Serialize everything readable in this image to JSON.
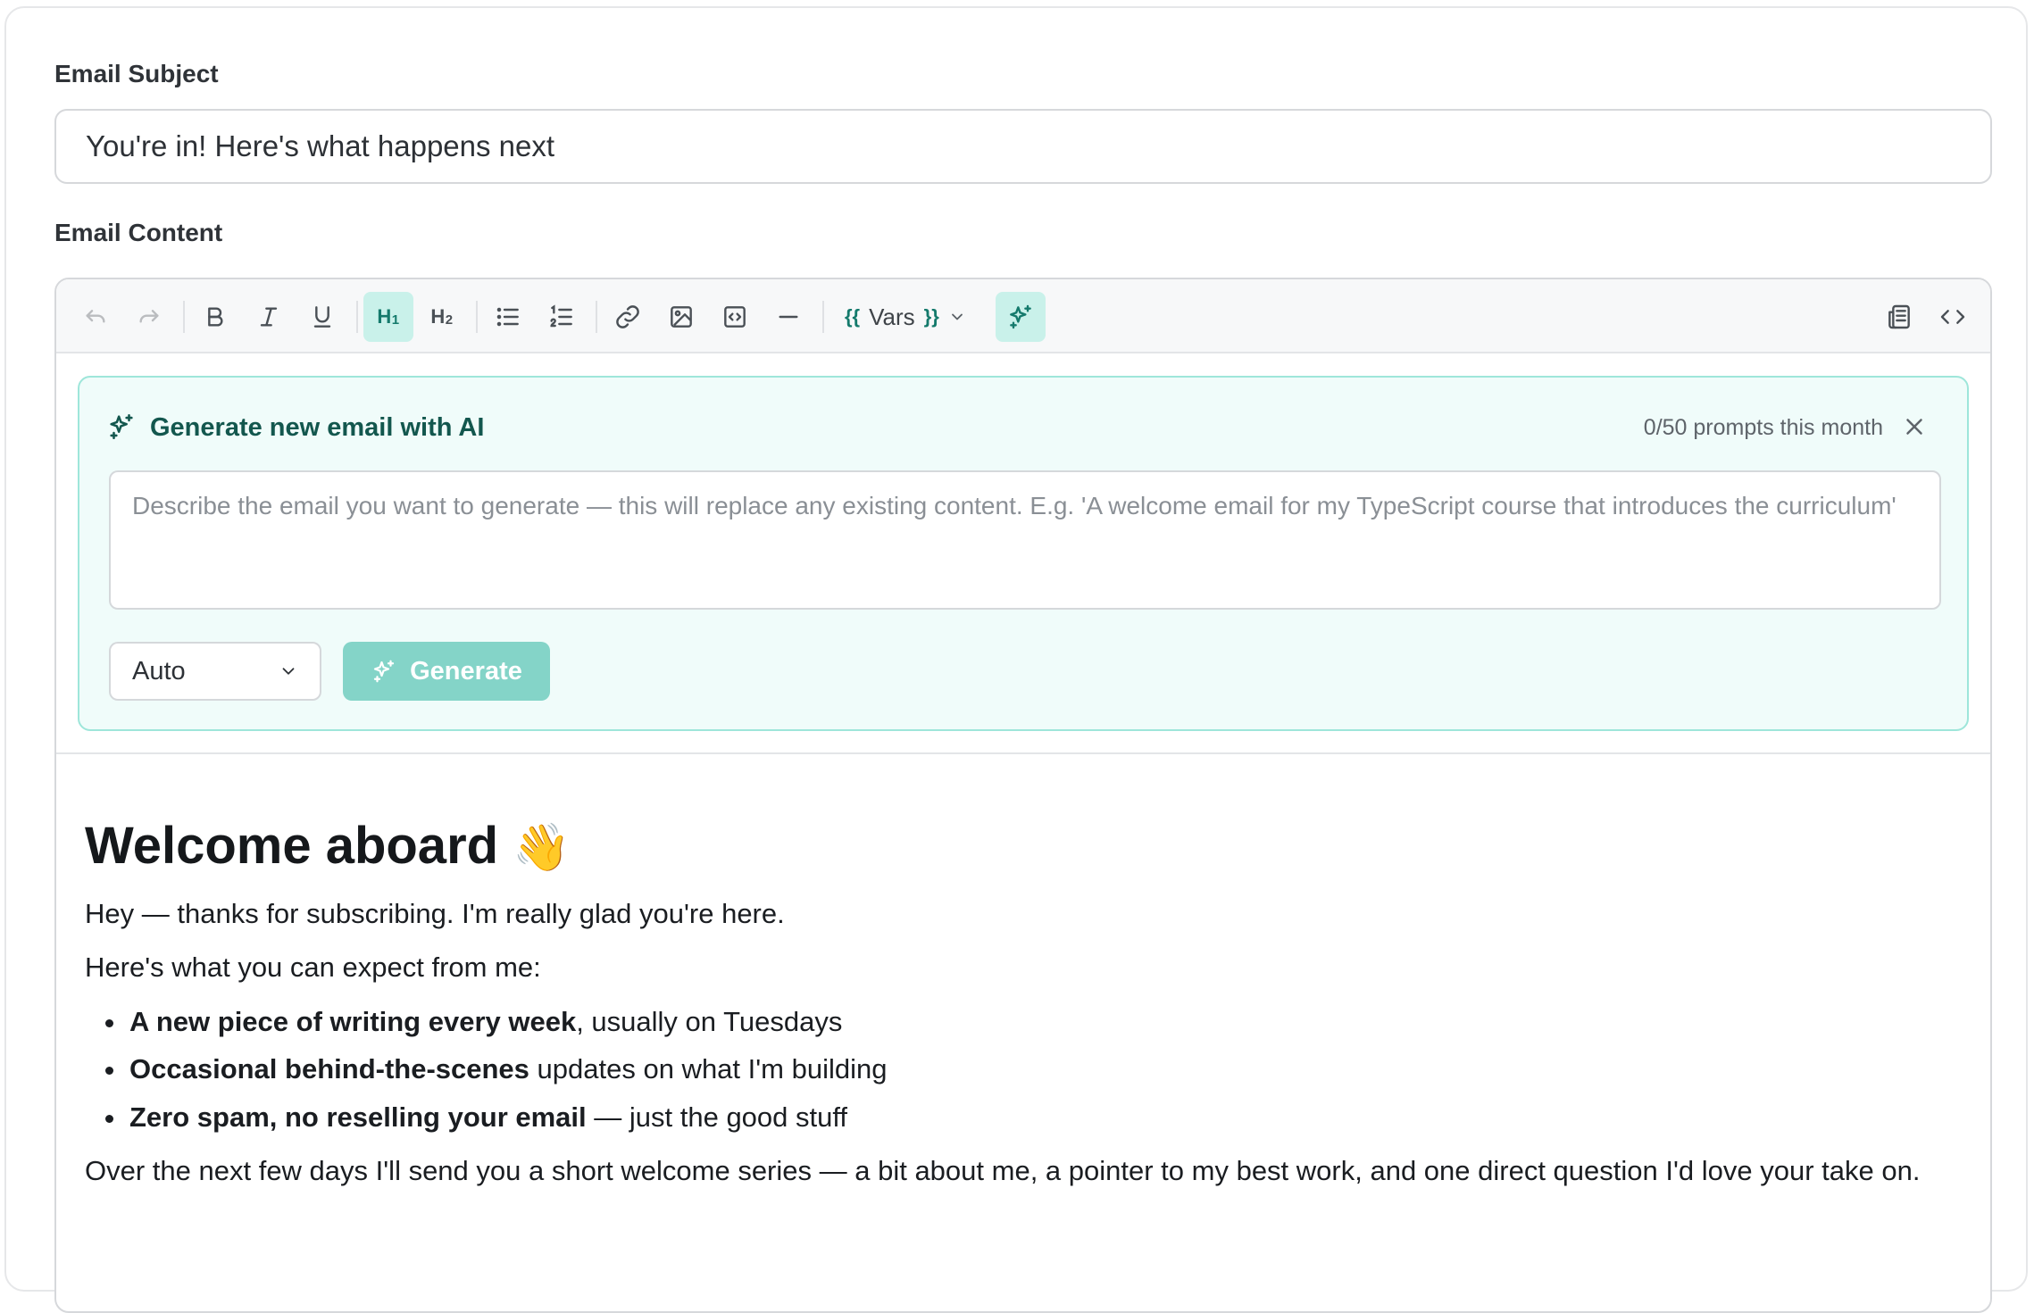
{
  "subject": {
    "label": "Email Subject",
    "value": "You're in! Here's what happens next"
  },
  "content_label": "Email Content",
  "toolbar": {
    "h1": "H",
    "h1_sub": "1",
    "h2": "H",
    "h2_sub": "2",
    "vars_label": "Vars",
    "vars_open": "{{",
    "vars_close": "}}"
  },
  "ai": {
    "title": "Generate new email with AI",
    "usage": "0/50 prompts this month",
    "prompt_placeholder": "Describe the email you want to generate — this will replace any existing content. E.g. 'A welcome email for my TypeScript course that introduces the curriculum'",
    "prompt_value": "",
    "mode": "Auto",
    "generate_label": "Generate",
    "accent": "#147a6c"
  },
  "body": {
    "heading": "Welcome aboard",
    "heading_emoji": "👋",
    "intro": "Hey — thanks for subscribing. I'm really glad you're here.",
    "expect": "Here's what you can expect from me:",
    "bullets": [
      {
        "bold": "A new piece of writing every week",
        "rest": ", usually on Tuesdays"
      },
      {
        "bold": "Occasional behind-the-scenes",
        "rest": " updates on what I'm building"
      },
      {
        "bold": "Zero spam, no reselling your email",
        "rest": " — just the good stuff"
      }
    ],
    "closing": "Over the next few days I'll send you a short welcome series — a bit about me, a pointer to my best work, and one direct question I'd love your take on."
  }
}
